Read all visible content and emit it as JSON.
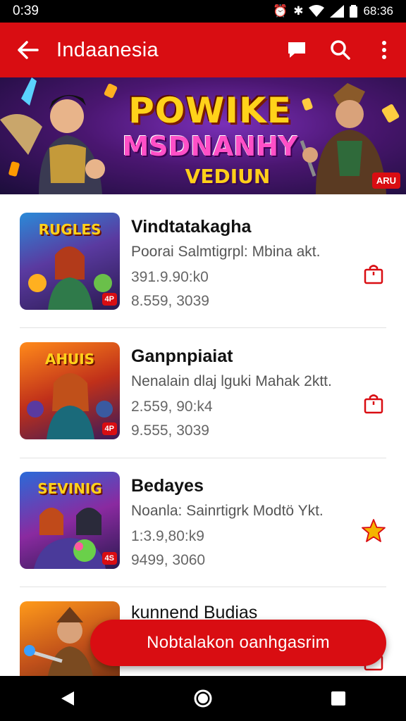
{
  "status_bar": {
    "time": "0:39",
    "clock_right": "68:36"
  },
  "app_bar": {
    "title": "Indaanesia"
  },
  "banner": {
    "line1": "POWIKE",
    "line2": "MSDNANHY",
    "line3": "VEDIUN",
    "badge": "ARU"
  },
  "list": {
    "items": [
      {
        "title": "Vindtatakagha",
        "desc": "Poorai Salmtigrpl: Mbina akt.",
        "meta1": "391.9.90:k0",
        "meta2": "8.559, 3039",
        "thumb_tag": "4P",
        "thumb_logo": "RUGLES",
        "action_icon": "shopping-bag-icon"
      },
      {
        "title": "Ganpnpiaiat",
        "desc": "Nenalain dlaj lguki Mahak 2ktt.",
        "meta1": "2.559, 90:k4",
        "meta2": "9.555, 3039",
        "thumb_tag": "4P",
        "thumb_logo": "AHUIS",
        "action_icon": "shopping-bag-icon"
      },
      {
        "title": "Bedayes",
        "desc": "Noanla: Sainrtigrk Modtö Ykt.",
        "meta1": "1:3.9,80:k9",
        "meta2": "9499, 3060",
        "thumb_tag": "4S",
        "thumb_logo": "SEVINIG",
        "action_icon": "star-icon"
      },
      {
        "title": "kunnend Budias",
        "desc": "",
        "meta1": "",
        "meta2": "",
        "thumb_tag": "",
        "thumb_logo": "",
        "action_icon": "shopping-bag-icon"
      }
    ]
  },
  "fab": {
    "label": "Nobtalakon oanhgasrim"
  },
  "colors": {
    "primary": "#d90d12",
    "star": "#f5b400"
  }
}
